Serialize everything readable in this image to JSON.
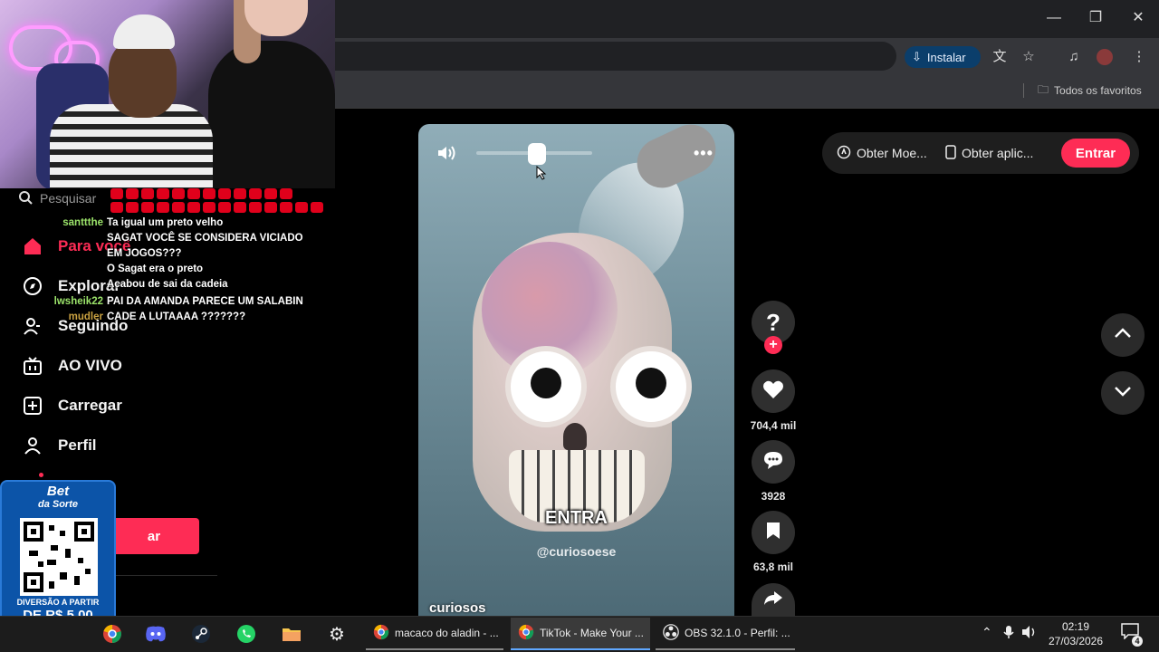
{
  "browser": {
    "install_label": "Instalar",
    "bookmarks_all": "Todos os favoritos"
  },
  "chat": [
    {
      "user": "santtthe",
      "user_color": "#9be36a",
      "msg": "Ta igual um preto velho"
    },
    {
      "user": "",
      "user_color": "#3a5bff",
      "msg": "SAGAT VOCÊ SE CONSIDERA VICIADO EM JOGOS???"
    },
    {
      "user": "",
      "user_color": "#3a5bff",
      "msg": "O Sagat era o preto"
    },
    {
      "user": "",
      "user_color": "#3a5bff",
      "msg": "Acabou de sai da cadeia"
    },
    {
      "user": "lwsheik22",
      "user_color": "#9be36a",
      "msg": "PAI DA AMANDA PARECE UM SALABIN"
    },
    {
      "user": "mudler",
      "user_color": "#c8a040",
      "msg": "CADE A LUTAAAA ???????"
    }
  ],
  "sidebar": {
    "search_placeholder": "Pesquisar",
    "items": [
      {
        "label": "Para você",
        "icon": "home-icon"
      },
      {
        "label": "Explorar",
        "icon": "compass-icon"
      },
      {
        "label": "Seguindo",
        "icon": "following-icon"
      },
      {
        "label": "AO VIVO",
        "icon": "live-icon"
      },
      {
        "label": "Carregar",
        "icon": "upload-icon"
      },
      {
        "label": "Perfil",
        "icon": "profile-icon"
      }
    ],
    "login_label": "ar"
  },
  "ad": {
    "logo_line1": "Bet",
    "logo_line2": "da Sorte",
    "line1": "DIVERSÃO A PARTIR",
    "line2": "DE R$ 5,00"
  },
  "video": {
    "caption": "ENTRA",
    "watermark": "@curiosoese",
    "author": "curiosos",
    "volume": 0.52
  },
  "actions": {
    "likes": "704,4 mil",
    "comments": "3928",
    "saves": "63,8 mil"
  },
  "header": {
    "coins_label": "Obter Moe...",
    "app_label": "Obter aplic...",
    "enter_label": "Entrar"
  },
  "taskbar": {
    "tasks": [
      {
        "label": "macaco do aladin - ..."
      },
      {
        "label": "TikTok - Make Your ..."
      },
      {
        "label": "OBS 32.1.0 - Perfil: ..."
      }
    ],
    "time": "02:19",
    "date": "27/03/2026",
    "notification_count": "4"
  },
  "colors": {
    "accent": "#fe2c55",
    "background": "#000000"
  }
}
